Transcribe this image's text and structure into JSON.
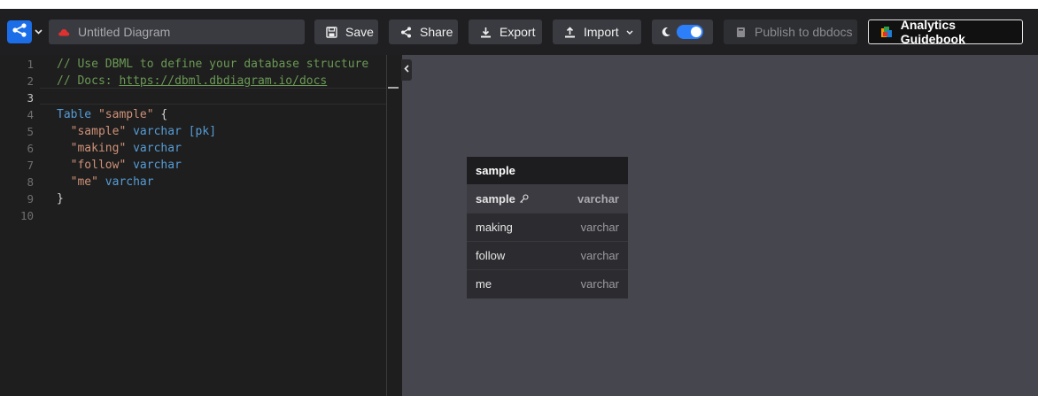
{
  "toolbar": {
    "title_placeholder": "Untitled Diagram",
    "save_label": "Save",
    "share_label": "Share",
    "export_label": "Export",
    "import_label": "Import",
    "publish_label": "Publish to dbdocs",
    "guide_label": "Analytics Guidebook",
    "theme_toggle_on": true,
    "accent_color": "#1c6ee8"
  },
  "editor": {
    "line_numbers": [
      "1",
      "2",
      "3",
      "4",
      "5",
      "6",
      "7",
      "8",
      "9",
      "10"
    ],
    "active_line": "3",
    "line1_comment": "// Use DBML to define your database structure",
    "line2_prefix": "// Docs: ",
    "line2_url": "https://dbml.dbdiagram.io/docs",
    "line4_kw": "Table",
    "line4_name": "\"sample\"",
    "line4_brace": " {",
    "line5_col": "\"sample\"",
    "line5_type": "varchar",
    "line5_attr": "[pk]",
    "line6_col": "\"making\"",
    "line6_type": "varchar",
    "line7_col": "\"follow\"",
    "line7_type": "varchar",
    "line8_col": "\"me\"",
    "line8_type": "varchar",
    "line9_close": "}"
  },
  "diagram": {
    "table_name": "sample",
    "columns": [
      {
        "name": "sample",
        "type": "varchar",
        "pk": true
      },
      {
        "name": "making",
        "type": "varchar"
      },
      {
        "name": "follow",
        "type": "varchar"
      },
      {
        "name": "me",
        "type": "varchar"
      }
    ]
  },
  "icons": {
    "logo": "share-nodes-icon",
    "cloud": "cloud-icon",
    "save": "floppy-icon",
    "share": "share-icon",
    "export": "download-icon",
    "import": "upload-icon",
    "theme": "moon-icon",
    "publish": "book-icon",
    "guide": "chart-icon",
    "collapse": "chevron-left-icon",
    "key": "key-icon"
  }
}
